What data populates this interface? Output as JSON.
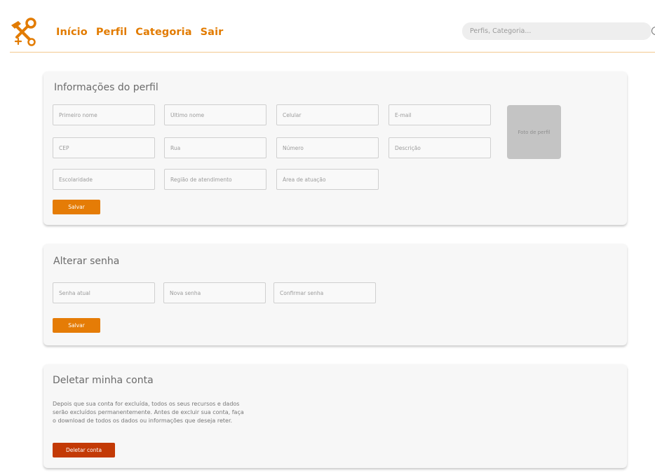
{
  "header": {
    "nav": [
      {
        "label": "Início"
      },
      {
        "label": "Perfil"
      },
      {
        "label": "Categoria"
      },
      {
        "label": "Sair"
      }
    ],
    "search_placeholder": "Perfis, Categoria..."
  },
  "profile": {
    "title": "Informações do perfil",
    "fields": {
      "first_name": "Primeiro nome",
      "last_name": "Último nome",
      "phone": "Celular",
      "email": "E-mail",
      "cep": "CEP",
      "street": "Rua",
      "number": "Número",
      "description": "Descrição",
      "education": "Escolaridade",
      "region": "Região de atendimento",
      "area": "Área de atuação"
    },
    "photo_label": "Foto de perfil",
    "save_label": "Salvar"
  },
  "password": {
    "title": "Alterar senha",
    "fields": {
      "current": "Senha atual",
      "new": "Nova senha",
      "confirm": "Confirmar senha"
    },
    "save_label": "Salvar"
  },
  "delete": {
    "title": "Deletar minha conta",
    "description_lines": [
      "Depois que sua conta for excluída, todos os seus recursos e dados",
      "serão excluídos permanentemente. Antes de excluir sua conta, faça",
      "o download de todos os dados ou informações que deseja reter."
    ],
    "button_label": "Deletar conta"
  },
  "colors": {
    "accent": "#e27b00",
    "danger": "#c33a06",
    "card_bg": "#f7f7f7"
  }
}
